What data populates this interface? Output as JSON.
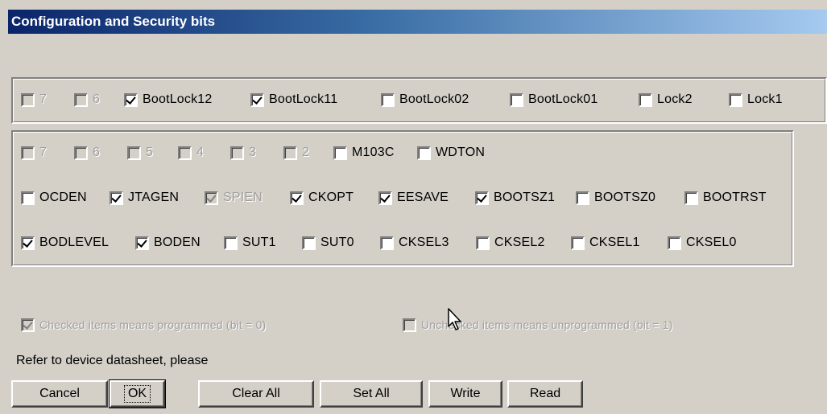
{
  "window": {
    "title": "Configuration and Security bits"
  },
  "lock_bits": [
    {
      "label": "7",
      "checked": false,
      "enabled": false
    },
    {
      "label": "6",
      "checked": false,
      "enabled": false
    },
    {
      "label": "BootLock12",
      "checked": true,
      "enabled": true
    },
    {
      "label": "BootLock11",
      "checked": true,
      "enabled": true
    },
    {
      "label": "BootLock02",
      "checked": false,
      "enabled": true
    },
    {
      "label": "BootLock01",
      "checked": false,
      "enabled": true
    },
    {
      "label": "Lock2",
      "checked": false,
      "enabled": true
    },
    {
      "label": "Lock1",
      "checked": false,
      "enabled": true
    }
  ],
  "fuse_rows": [
    [
      {
        "label": "7",
        "checked": false,
        "enabled": false
      },
      {
        "label": "6",
        "checked": false,
        "enabled": false
      },
      {
        "label": "5",
        "checked": false,
        "enabled": false
      },
      {
        "label": "4",
        "checked": false,
        "enabled": false
      },
      {
        "label": "3",
        "checked": false,
        "enabled": false
      },
      {
        "label": "2",
        "checked": false,
        "enabled": false
      },
      {
        "label": "M103C",
        "checked": false,
        "enabled": true
      },
      {
        "label": "WDTON",
        "checked": false,
        "enabled": true
      }
    ],
    [
      {
        "label": "OCDEN",
        "checked": false,
        "enabled": true
      },
      {
        "label": "JTAGEN",
        "checked": true,
        "enabled": true
      },
      {
        "label": "SPIEN",
        "checked": true,
        "enabled": false
      },
      {
        "label": "CKOPT",
        "checked": true,
        "enabled": true
      },
      {
        "label": "EESAVE",
        "checked": true,
        "enabled": true
      },
      {
        "label": "BOOTSZ1",
        "checked": true,
        "enabled": true
      },
      {
        "label": "BOOTSZ0",
        "checked": false,
        "enabled": true
      },
      {
        "label": "BOOTRST",
        "checked": false,
        "enabled": true
      }
    ],
    [
      {
        "label": "BODLEVEL",
        "checked": true,
        "enabled": true
      },
      {
        "label": "BODEN",
        "checked": true,
        "enabled": true
      },
      {
        "label": "SUT1",
        "checked": false,
        "enabled": true
      },
      {
        "label": "SUT0",
        "checked": false,
        "enabled": true
      },
      {
        "label": "CKSEL3",
        "checked": false,
        "enabled": true
      },
      {
        "label": "CKSEL2",
        "checked": false,
        "enabled": true
      },
      {
        "label": "CKSEL1",
        "checked": false,
        "enabled": true
      },
      {
        "label": "CKSEL0",
        "checked": false,
        "enabled": true
      }
    ]
  ],
  "legend": {
    "programmed": "Checked items means programmed (bit = 0)",
    "unprogrammed": "Unchecked items means unprogrammed (bit = 1)"
  },
  "refer_text": "Refer to device datasheet, please",
  "buttons": {
    "cancel": "Cancel",
    "ok": "OK",
    "clear_all": "Clear All",
    "set_all": "Set All",
    "write": "Write",
    "read": "Read"
  },
  "colors": {
    "title_start": "#0a246a",
    "title_end": "#a6caf0",
    "face": "#d4d0c8"
  }
}
